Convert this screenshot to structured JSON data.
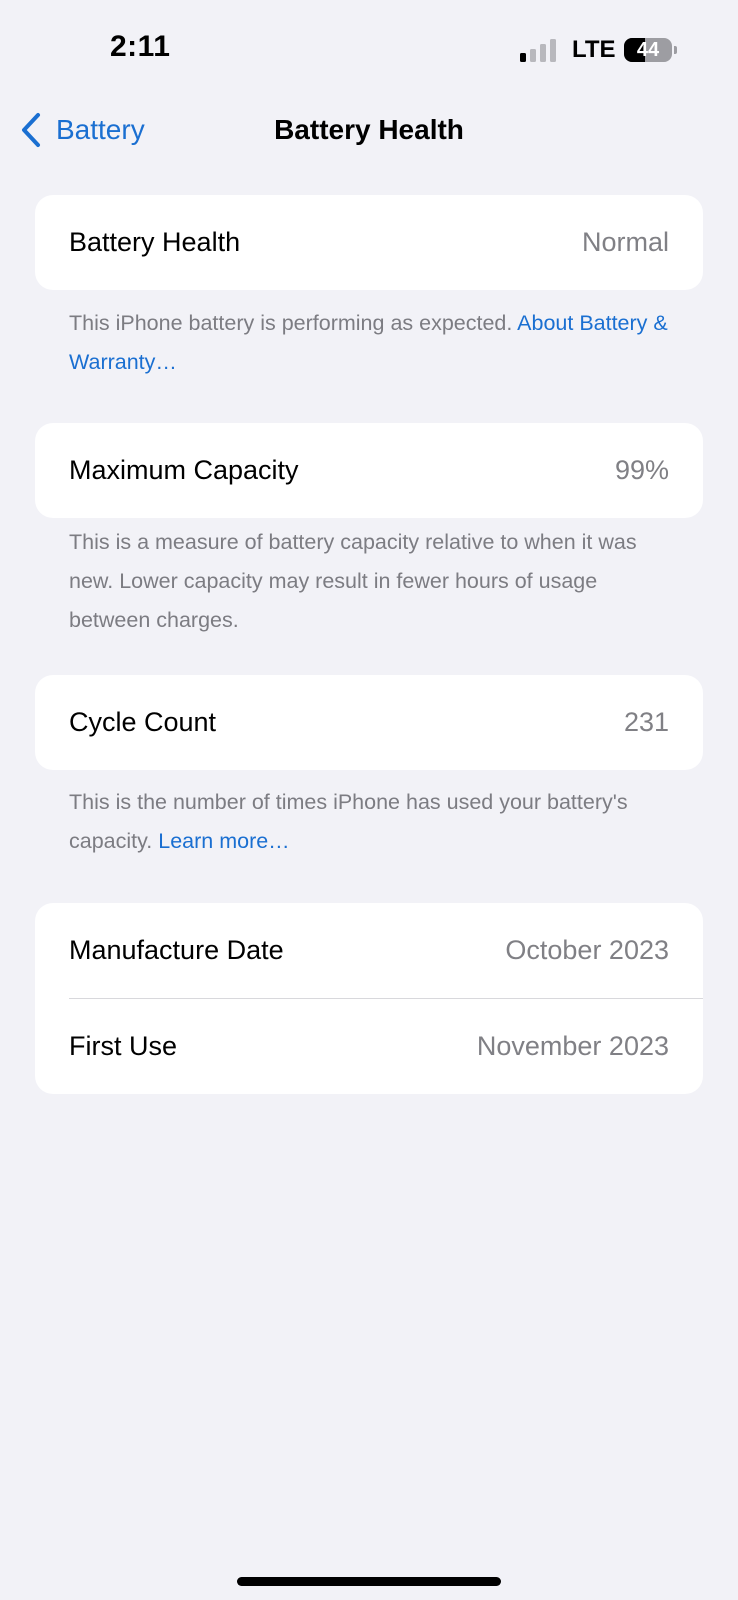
{
  "status_bar": {
    "time": "2:11",
    "network": "LTE",
    "battery_percent": "44",
    "battery_level": 0.44,
    "signal_bars_active": 1,
    "signal_bars_total": 4
  },
  "nav": {
    "back_label": "Battery",
    "title": "Battery Health"
  },
  "sections": {
    "health": {
      "label": "Battery Health",
      "value": "Normal",
      "footer_text": "This iPhone battery is performing as expected. ",
      "footer_link": "About Battery & Warranty…"
    },
    "capacity": {
      "label": "Maximum Capacity",
      "value": "99%",
      "footer_text": "This is a measure of battery capacity relative to when it was new. Lower capacity may result in fewer hours of usage between charges."
    },
    "cycles": {
      "label": "Cycle Count",
      "value": "231",
      "footer_text": "This is the number of times iPhone has used your battery's capacity. ",
      "footer_link": "Learn more…"
    },
    "dates": {
      "manufacture_label": "Manufacture Date",
      "manufacture_value": "October 2023",
      "first_use_label": "First Use",
      "first_use_value": "November 2023"
    }
  },
  "colors": {
    "accent": "#1a6fd1",
    "background": "#f2f2f7",
    "secondary_text": "#808085"
  }
}
